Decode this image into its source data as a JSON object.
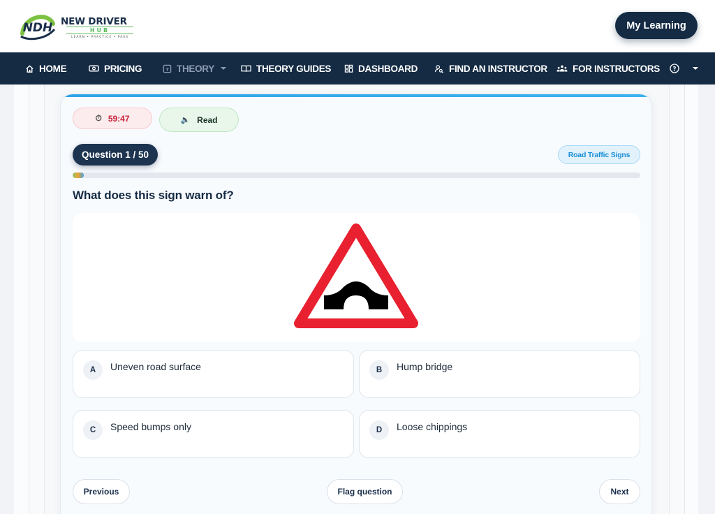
{
  "brand": {
    "logo_mark": "NDH",
    "name": "NEW DRIVER",
    "name_sub": "HUB",
    "tagline": "LEARN • PRACTICE • PASS"
  },
  "header": {
    "my_learning_label": "My Learning"
  },
  "nav": {
    "items": [
      {
        "label": "HOME",
        "icon": "home-icon"
      },
      {
        "label": "PRICING",
        "icon": "money-icon"
      },
      {
        "label": "THEORY",
        "icon": "theory-icon",
        "dropdown": true,
        "active": true
      },
      {
        "label": "THEORY GUIDES",
        "icon": "book-icon"
      },
      {
        "label": "DASHBOARD",
        "icon": "dashboard-icon"
      },
      {
        "label": "FIND AN INSTRUCTOR",
        "icon": "user-search-icon"
      },
      {
        "label": "FOR INSTRUCTORS",
        "icon": "group-icon"
      }
    ],
    "help_icon": "help-icon"
  },
  "quiz": {
    "timer": "59:47",
    "timer_icon": "stopwatch-icon",
    "read_label": "Read",
    "read_icon": "speaker-icon",
    "question_counter": "Question 1 / 50",
    "category": "Road Traffic Signs",
    "progress": 0.02,
    "question_text": "What does this sign warn of?",
    "sign_icon": "hump-bridge-warning-sign",
    "options": [
      {
        "letter": "A",
        "text": "Uneven road surface"
      },
      {
        "letter": "B",
        "text": "Hump bridge"
      },
      {
        "letter": "C",
        "text": "Speed bumps only"
      },
      {
        "letter": "D",
        "text": "Loose chippings"
      }
    ],
    "previous_label": "Previous",
    "flag_label": "Flag question",
    "next_label": "Next"
  },
  "colors": {
    "navy": "#152b44",
    "accent_blue": "#2fa2e8",
    "sign_red": "#e8202f",
    "timer_red": "#c8243a"
  }
}
